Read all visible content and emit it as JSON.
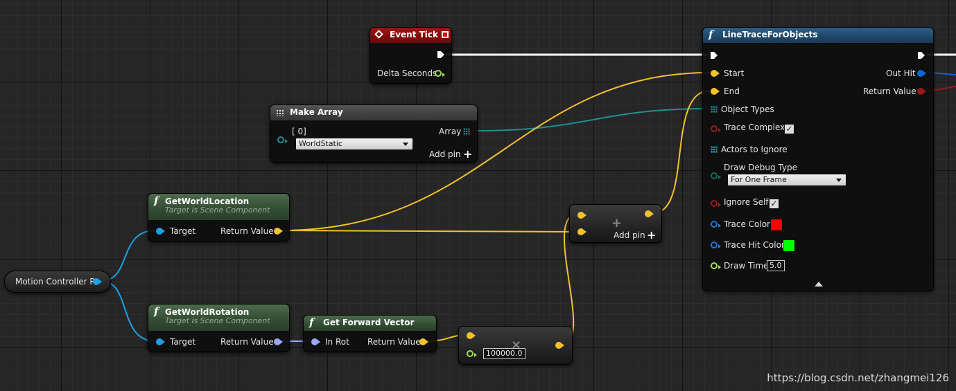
{
  "colors": {
    "exec": "#ffffff",
    "vector": "#f3c12b",
    "float": "#9be04f",
    "object": "#1fa0e6",
    "rotator": "#9aa6ff",
    "struct": "#1366d6",
    "bool": "#9a1a1a",
    "array": "#1f8f8f",
    "linecolor": "#1e74d6",
    "enum": "#0e6e60"
  },
  "nodes": {
    "event_tick": {
      "title": "Event Tick",
      "delta": "Delta Seconds"
    },
    "make_array": {
      "title": "Make Array",
      "index": "[ 0]",
      "value": "WorldStatic",
      "out": "Array",
      "add_pin": "Add pin"
    },
    "get_world_location": {
      "title": "GetWorldLocation",
      "subtitle": "Target is Scene Component",
      "target": "Target",
      "ret": "Return Value"
    },
    "get_world_rotation": {
      "title": "GetWorldRotation",
      "subtitle": "Target is Scene Component",
      "target": "Target",
      "ret": "Return Value"
    },
    "motion_controller": {
      "label": "Motion Controller R"
    },
    "get_forward_vector": {
      "title": "Get Forward Vector",
      "in": "In Rot",
      "ret": "Return Value"
    },
    "add": {
      "op": "+",
      "add_pin": "Add pin"
    },
    "multiply": {
      "op": "×",
      "value": "100000.0"
    },
    "line_trace": {
      "title": "LineTraceForObjects",
      "start": "Start",
      "end": "End",
      "object_types": "Object Types",
      "trace_complex": "Trace Complex",
      "actors_to_ignore": "Actors to Ignore",
      "draw_debug_type": "Draw Debug Type",
      "draw_debug_value": "For One Frame",
      "ignore_self": "Ignore Self",
      "trace_color": "Trace Color",
      "trace_hit_color": "Trace Hit Color",
      "draw_time": "Draw Time",
      "draw_time_value": "5.0",
      "out_hit": "Out Hit",
      "return_value": "Return Value",
      "trace_color_value": "#ff0000",
      "trace_hit_color_value": "#00ff00"
    }
  },
  "watermark": "https://blog.csdn.net/zhangmei126"
}
